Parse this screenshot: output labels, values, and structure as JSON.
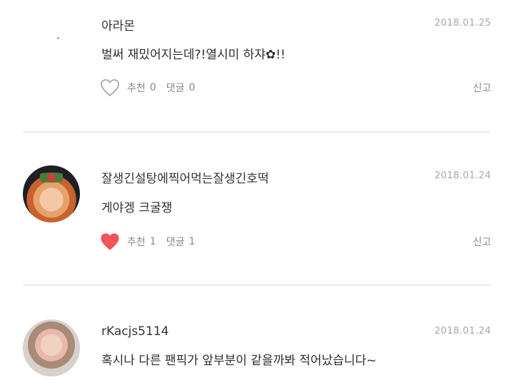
{
  "comments": [
    {
      "author": "아라몬",
      "date": "2018.01.25",
      "text": "벌써 재밌어지는데?!열시미 하쟈✿!!",
      "like_label": "추천",
      "like_count": "0",
      "reply_label": "댓글",
      "reply_count": "0",
      "report": "신고",
      "liked": false
    },
    {
      "author": "잘생긴설탕에찍어먹는잘생긴호떡",
      "date": "2018.01.24",
      "text": "게야겡 크굴쟁",
      "like_label": "추천",
      "like_count": "1",
      "reply_label": "댓글",
      "reply_count": "1",
      "report": "신고",
      "liked": true
    },
    {
      "author": "rKacjs5114",
      "date": "2018.01.24",
      "text": "혹시나 다른 팬픽가 앞부분이 같을까봐 적어났습니다~"
    }
  ],
  "colors": {
    "heart_filled": "#f0555a",
    "heart_outline": "#9aa0a6",
    "divider": "#e6eef0"
  },
  "icons": {
    "like_empty": "heart-outline-icon",
    "like_filled": "heart-filled-icon"
  }
}
